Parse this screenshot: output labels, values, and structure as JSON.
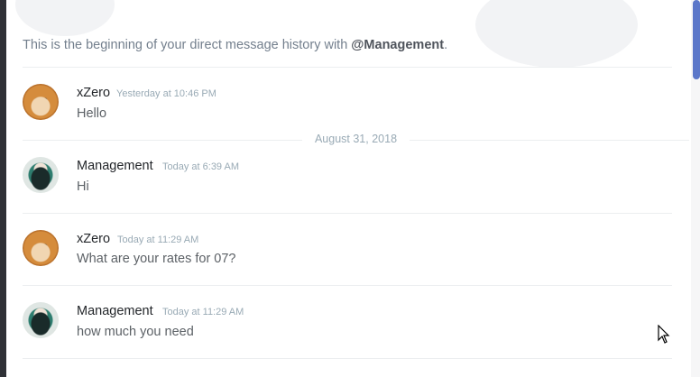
{
  "intro": {
    "prefix": "This is the beginning of your direct message history with ",
    "mention": "@Management",
    "suffix": "."
  },
  "date_separator": "August 31, 2018",
  "messages": [
    {
      "author": "xZero",
      "timestamp": "Yesterday at 10:46 PM",
      "text": "Hello",
      "avatar": "shiba-dog-avatar"
    },
    {
      "author": "Management",
      "timestamp": "Today at 6:39 AM",
      "text": "Hi",
      "avatar": "green-hair-girl-avatar"
    },
    {
      "author": "xZero",
      "timestamp": "Today at 11:29 AM",
      "text": "What are your rates for 07?",
      "avatar": "shiba-dog-avatar"
    },
    {
      "author": "Management",
      "timestamp": "Today at 11:29 AM",
      "text": "how much you need",
      "avatar": "green-hair-girl-avatar"
    }
  ],
  "colors": {
    "accent": "#5b77c9",
    "username": "#23262a",
    "timestamp": "#99aab5",
    "message": "#5c6166"
  }
}
